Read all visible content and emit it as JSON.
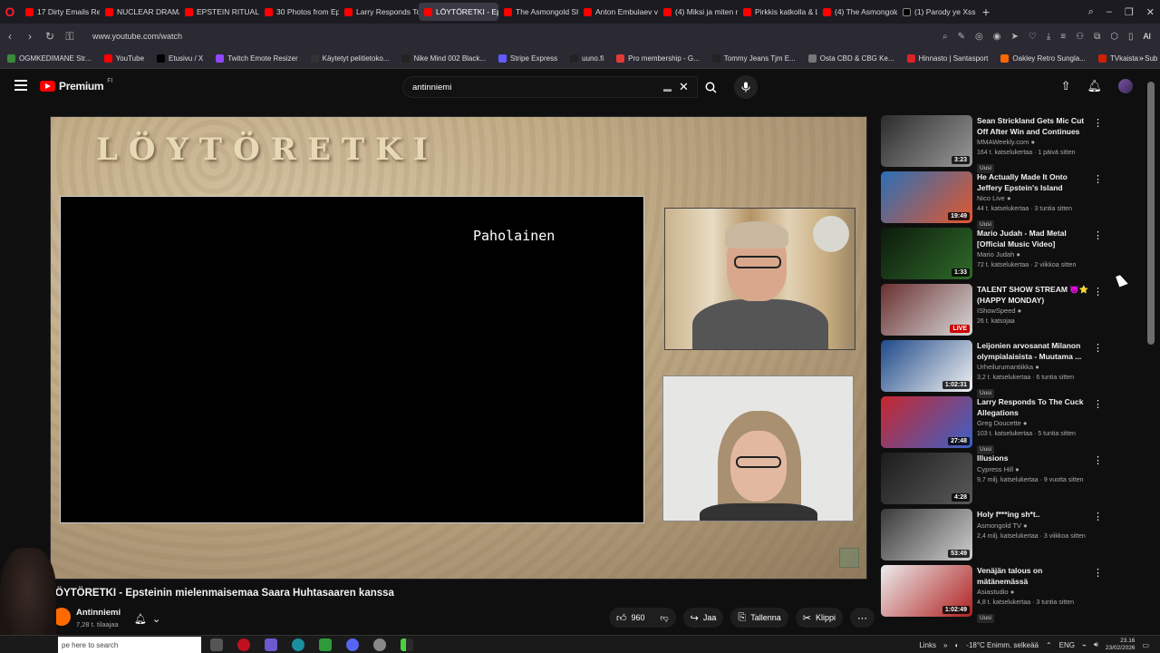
{
  "browser": {
    "logo": "O",
    "tabs": [
      {
        "label": "17 Dirty Emails Rel",
        "active": false
      },
      {
        "label": "NUCLEAR DRAMA",
        "active": false
      },
      {
        "label": "EPSTEIN RITUALS E",
        "active": false
      },
      {
        "label": "30 Photos from Ep",
        "active": false
      },
      {
        "label": "Larry Responds To T",
        "active": false
      },
      {
        "label": "LÖYTÖRETKI - Epstein",
        "active": true
      },
      {
        "label": "The Asmongold Sh",
        "active": false
      },
      {
        "label": "Anton Embulaev vi",
        "active": false
      },
      {
        "label": "(4) Miksi ja miten n",
        "active": false
      },
      {
        "label": "Pirkkis katkolla & L",
        "active": false
      },
      {
        "label": "(4) The Asmongold",
        "active": false
      },
      {
        "label": "(1) Parody ye Xss",
        "active": false
      }
    ],
    "new_tab": "+",
    "url": "www.youtube.com/watch",
    "ai_label": "AI"
  },
  "bookmarks": [
    "OGMKEDIMANE Str...",
    "YouTube",
    "Etusivu / X",
    "Twitch Emote Resizer",
    "Käytetyt pelitietoko...",
    "Nike Mind 002 Black...",
    "Stripe Express",
    "uuno.fi",
    "Pro membership - G...",
    "Tommy Jeans Tjm E...",
    "Osta CBD & CBG Ke...",
    "Hinnasto | Santasport",
    "Oakley Retro Sungla...",
    "TVkaista - Sub Suora"
  ],
  "youtube": {
    "logo_text": "Premium",
    "logo_sup": "FI",
    "search_value": "antinniemi"
  },
  "player": {
    "overlay_title": "LÖYTÖRETKI",
    "slide_text": "Paholainen"
  },
  "video": {
    "title": "LÖYTÖRETKI - Epsteinin mielenmaisemaa Saara Huhtasaaren kanssa",
    "channel": "Antinniemi",
    "subs": "7,28 t. tilaajaa",
    "likes": "960",
    "share": "Jaa",
    "save": "Tallenna",
    "clip": "Klippi"
  },
  "sidebar": [
    {
      "title": "Sean Strickland Gets Mic Cut Off After Win and Continues",
      "channel": "MMAWeekly.com",
      "stats": "164 t. katselukertaa · 1 päivä sitten",
      "badge": "Uusi",
      "duration": "3:23",
      "live": false,
      "colors": [
        "#2c2c2c",
        "#9a9a9a"
      ]
    },
    {
      "title": "He Actually Made It Onto Jeffery Epstein's Island",
      "channel": "Nico Live",
      "stats": "44 t. katselukertaa · 3 tuntia sitten",
      "badge": "Uusi",
      "duration": "19:49",
      "live": false,
      "colors": [
        "#2a6fb5",
        "#e4572e"
      ]
    },
    {
      "title": "Mario Judah - Mad Metal [Official Music Video]",
      "channel": "Mario Judah",
      "stats": "72 t. katselukertaa · 2 viikkoa sitten",
      "badge": "",
      "duration": "1:33",
      "live": false,
      "colors": [
        "#0c1a0c",
        "#2f6b2a"
      ]
    },
    {
      "title": "TALENT SHOW STREAM 😈⭐ (HAPPY MONDAY)",
      "channel": "IShowSpeed",
      "stats": "26 t. katsojaa",
      "badge": "",
      "duration": "LIVE",
      "live": true,
      "colors": [
        "#6a3030",
        "#d8d8d8"
      ]
    },
    {
      "title": "Leijonien arvosanat Milanon olympialaisista - Muutama ...",
      "channel": "Urheilurumantiikka",
      "stats": "3,2 t. katselukertaa · 6 tuntia sitten",
      "badge": "Uusi",
      "duration": "1:02:31",
      "live": false,
      "colors": [
        "#1e4a8a",
        "#f2f2f2"
      ]
    },
    {
      "title": "Larry Responds To The Cuck Allegations",
      "channel": "Greg Doucette",
      "stats": "103 t. katselukertaa · 5 tuntia sitten",
      "badge": "Uusi",
      "duration": "27:48",
      "live": false,
      "colors": [
        "#c8262e",
        "#3a62c8"
      ]
    },
    {
      "title": "Illusions",
      "channel": "Cypress Hill",
      "stats": "9,7 milj. katselukertaa · 9 vuotta sitten",
      "badge": "",
      "duration": "4:28",
      "live": false,
      "colors": [
        "#1c1c1c",
        "#5a5a5a"
      ]
    },
    {
      "title": "Holy f***ing sh*t..",
      "channel": "Asmongold TV",
      "stats": "2,4 milj. katselukertaa · 3 viikkoa sitten",
      "badge": "",
      "duration": "53:49",
      "live": false,
      "colors": [
        "#3a3a3a",
        "#cfcfcf"
      ]
    },
    {
      "title": "Venäjän talous on mätänemässä",
      "channel": "Asiastudio",
      "stats": "4,8 t. katselukertaa · 3 tuntia sitten",
      "badge": "Uusi",
      "duration": "1:02:49",
      "live": false,
      "colors": [
        "#ececec",
        "#b02020"
      ]
    }
  ],
  "taskbar": {
    "search_placeholder": "pe here to search",
    "links": "Links",
    "weather": "-18°C Enimm. selkeää",
    "lang": "ENG",
    "time": "23.16",
    "date": "23/02/2026"
  }
}
